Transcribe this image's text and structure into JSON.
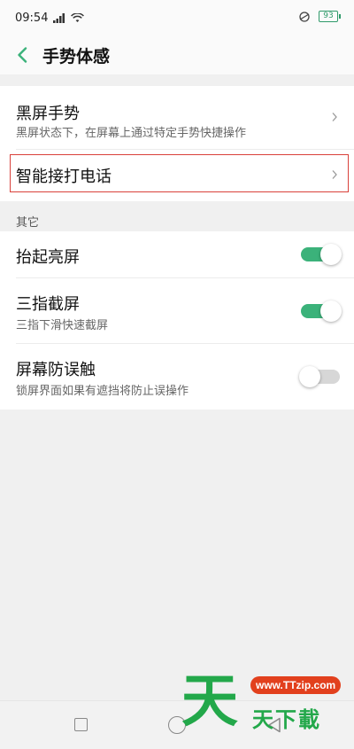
{
  "status_bar": {
    "time": "09:54",
    "battery": "93",
    "signal_icon": "signal-icon",
    "wifi_icon": "wifi-icon",
    "volte_icon": "volte-icon"
  },
  "header": {
    "title": "手势体感",
    "back_icon": "chevron-left-icon"
  },
  "gestures": {
    "black_screen": {
      "title": "黑屏手势",
      "subtitle": "黑屏状态下，在屏幕上通过特定手势快捷操作"
    },
    "smart_call": {
      "title": "智能接打电话"
    }
  },
  "other": {
    "section_label": "其它",
    "items": [
      {
        "title": "抬起亮屏",
        "subtitle": "",
        "enabled": true
      },
      {
        "title": "三指截屏",
        "subtitle": "三指下滑快速截屏",
        "enabled": true
      },
      {
        "title": "屏幕防误触",
        "subtitle": "锁屏界面如果有遮挡将防止误操作",
        "enabled": false
      }
    ]
  },
  "watermark": {
    "big_char": "天",
    "url": "www.TTzip.com",
    "text": "天下載"
  },
  "colors": {
    "accent": "#3bb27a",
    "highlight_border": "#d9413a",
    "watermark_green": "#23a84a",
    "watermark_red": "#e2401d"
  }
}
